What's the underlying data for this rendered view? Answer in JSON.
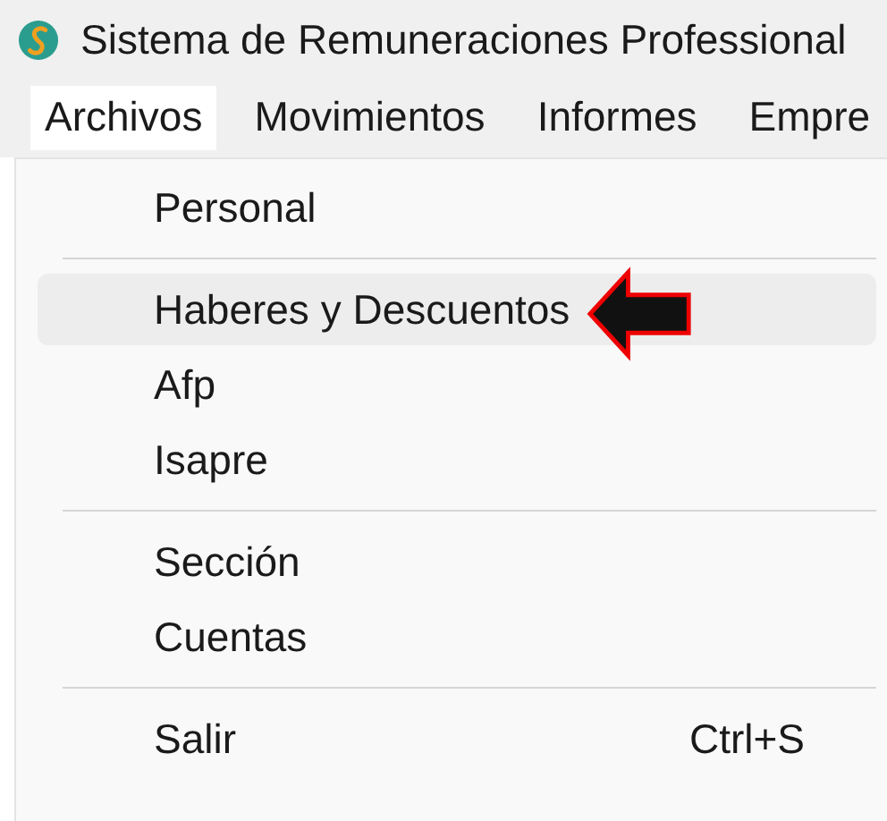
{
  "window": {
    "title": "Sistema de Remuneraciones Professional"
  },
  "menu_bar": [
    {
      "label": "Archivos",
      "selected": true
    },
    {
      "label": "Movimientos",
      "selected": false
    },
    {
      "label": "Informes",
      "selected": false
    },
    {
      "label": "Empre",
      "selected": false
    }
  ],
  "dropdown": [
    {
      "kind": "item",
      "label": "Personal",
      "highlighted": false,
      "pointed": false
    },
    {
      "kind": "separator"
    },
    {
      "kind": "item",
      "label": "Haberes y Descuentos",
      "highlighted": true,
      "pointed": true
    },
    {
      "kind": "item",
      "label": "Afp",
      "highlighted": false,
      "pointed": false
    },
    {
      "kind": "item",
      "label": "Isapre",
      "highlighted": false,
      "pointed": false
    },
    {
      "kind": "separator"
    },
    {
      "kind": "item",
      "label": "Sección",
      "highlighted": false,
      "pointed": false
    },
    {
      "kind": "item",
      "label": "Cuentas",
      "highlighted": false,
      "pointed": false
    },
    {
      "kind": "separator"
    },
    {
      "kind": "item",
      "label": "Salir",
      "shortcut": "Ctrl+S",
      "highlighted": false,
      "pointed": false
    }
  ]
}
